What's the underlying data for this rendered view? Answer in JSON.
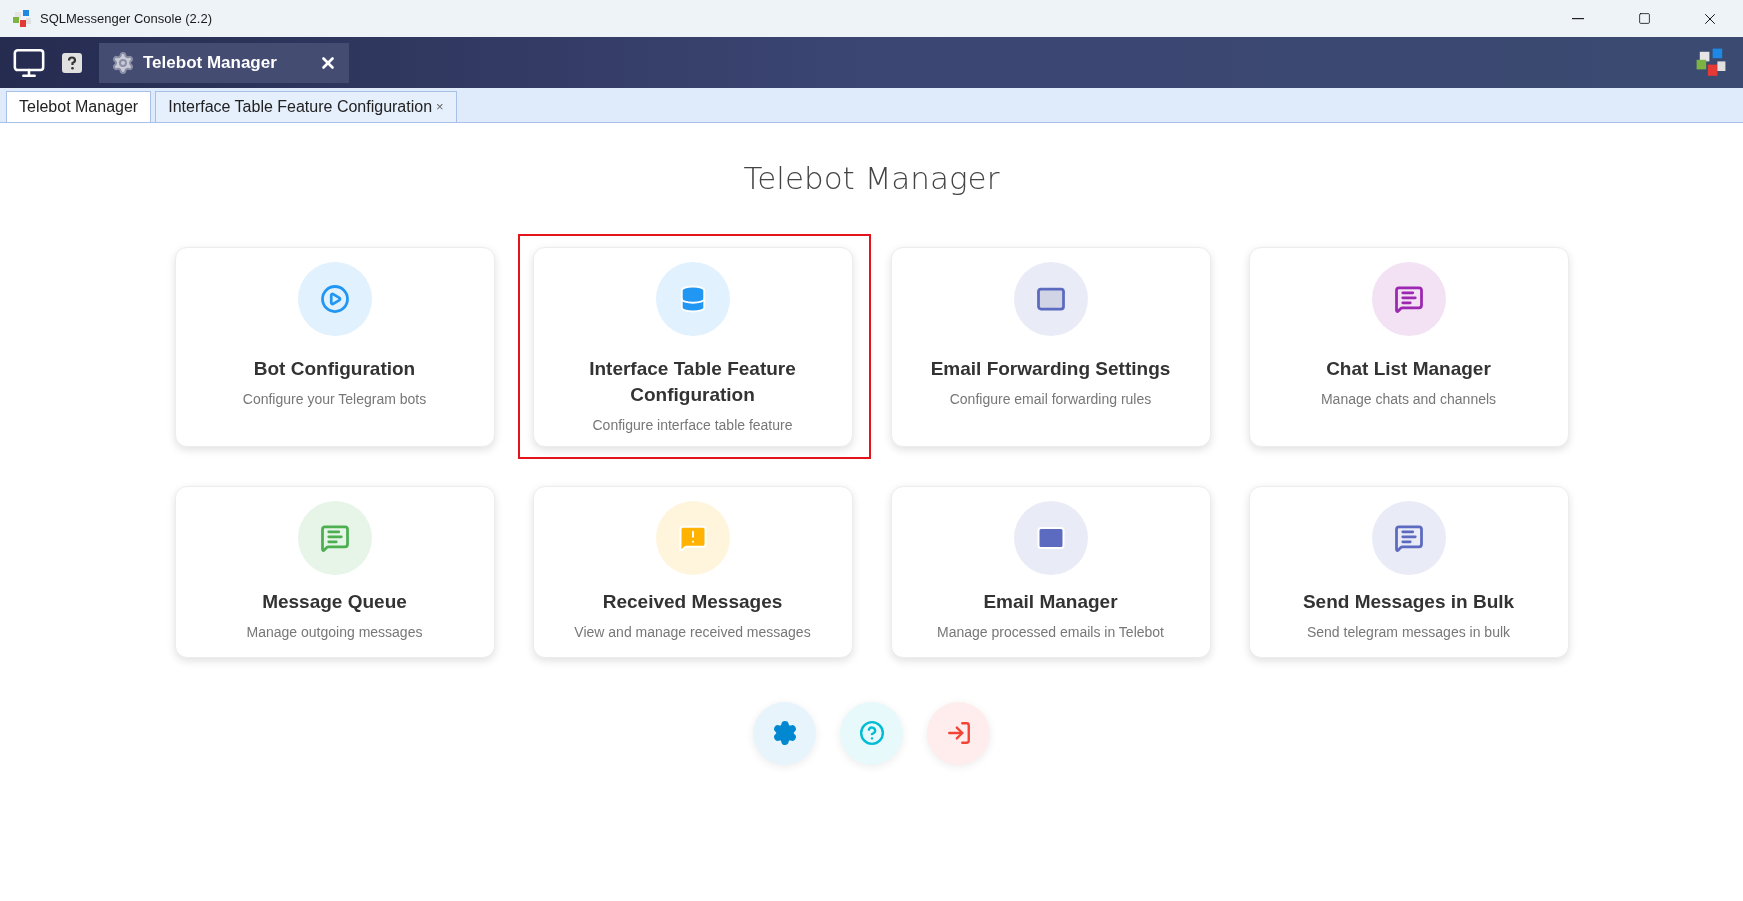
{
  "window": {
    "title": "SQLMessenger Console (2.2)"
  },
  "toolbar": {
    "active_tab": {
      "label": "Telebot Manager"
    }
  },
  "tabs": [
    {
      "label": "Telebot Manager",
      "selected": true
    },
    {
      "label": "Interface Table Feature Configuration",
      "selected": false,
      "close": "×"
    }
  ],
  "heading": "Telebot Manager",
  "cards": [
    {
      "kind": "play",
      "color": "#2196f3",
      "title": "Bot Configuration",
      "subtitle": "Configure your Telegram bots",
      "highlighted": false
    },
    {
      "kind": "database",
      "color": "#2196f3",
      "title": "Interface Table Feature Configuration",
      "subtitle": "Configure interface table feature",
      "highlighted": true
    },
    {
      "kind": "mail-outline",
      "color": "#5c6bc0",
      "title": "Email Forwarding Settings",
      "subtitle": "Configure email forwarding rules",
      "highlighted": false
    },
    {
      "kind": "chat",
      "color": "#9c27b0",
      "title": "Chat List Manager",
      "subtitle": "Manage chats and channels",
      "highlighted": false
    },
    {
      "kind": "message",
      "color": "#4caf50",
      "title": "Message Queue",
      "subtitle": "Manage outgoing messages",
      "highlighted": false
    },
    {
      "kind": "alert",
      "color": "#ffb300",
      "title": "Received Messages",
      "subtitle": "View and manage received messages",
      "highlighted": false
    },
    {
      "kind": "mail",
      "color": "#5c6bc0",
      "title": "Email Manager",
      "subtitle": "Manage processed emails in Telebot",
      "highlighted": false
    },
    {
      "kind": "message",
      "color": "#5c6bc0",
      "title": "Send Messages in Bulk",
      "subtitle": "Send telegram messages in bulk",
      "highlighted": false
    }
  ],
  "actions": [
    {
      "kind": "settings",
      "color": "#0288d1"
    },
    {
      "kind": "help",
      "color": "#00bcd4"
    },
    {
      "kind": "exit",
      "color": "#f44336"
    }
  ]
}
